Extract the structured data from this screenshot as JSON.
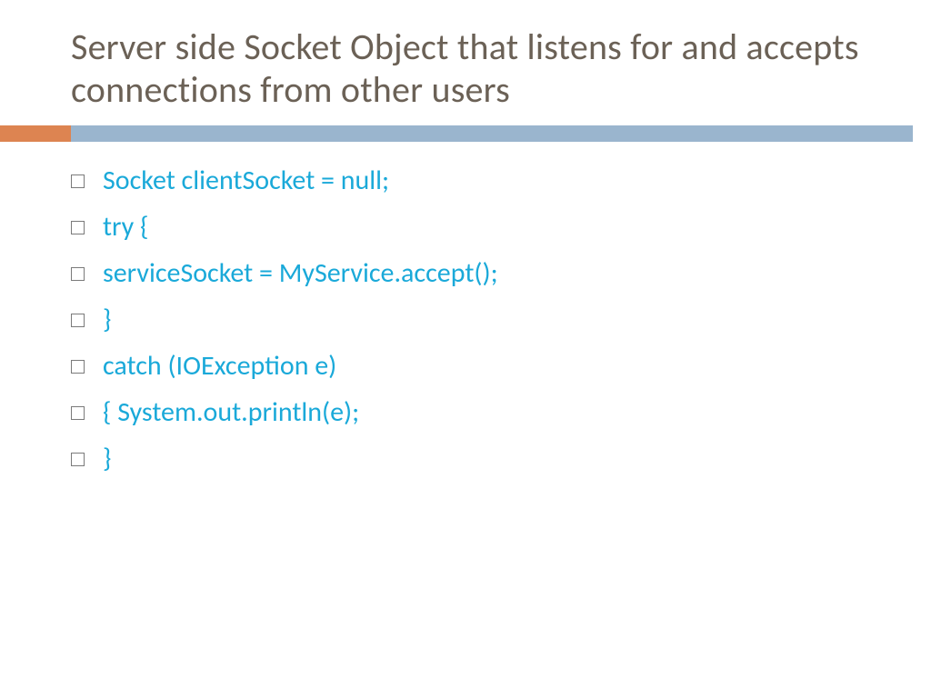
{
  "title": "Server side Socket Object that listens for and accepts connections from other users",
  "accent": {
    "orange": "#dd8451",
    "blue": "#9ab5ce"
  },
  "lines": [
    "Socket clientSocket = null;",
    "try {",
    "serviceSocket = MyService.accept();",
    "}",
    "catch (IOException e)",
    "{ System.out.println(e);",
    "}"
  ]
}
